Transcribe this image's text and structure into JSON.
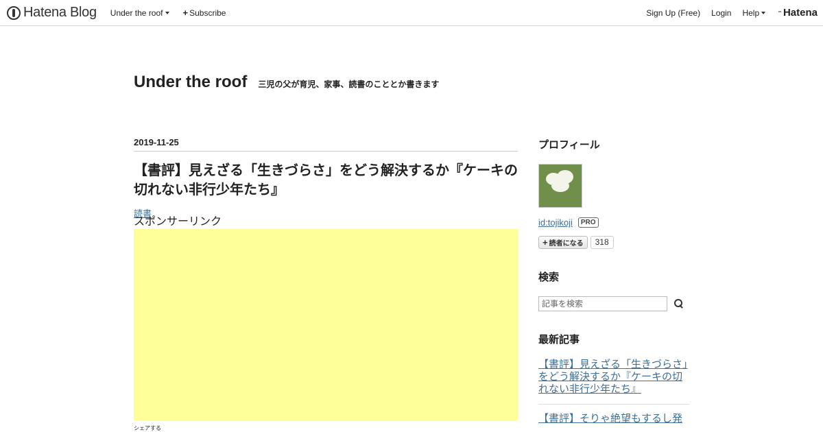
{
  "header": {
    "logo_text": "Hatena Blog",
    "blog_menu": "Under the roof",
    "subscribe": "Subscribe",
    "signup": "Sign Up (Free)",
    "login": "Login",
    "help": "Help",
    "hatena": "Hatena"
  },
  "blog": {
    "title": "Under the roof",
    "description": "三児の父が育児、家事、読書のこととか書きます"
  },
  "article": {
    "date": "2019-11-25",
    "title": "【書評】見えざる「生きづらさ」をどう解決するか『ケーキの切れない非行少年たち』",
    "category": "読書",
    "sponsor_label": "スポンサーリンク",
    "share_label": "シェアする",
    "share_colors": [
      "#1f8dd6",
      "#3b5998",
      "#55acee",
      "#dd4b39",
      "#e0455c"
    ]
  },
  "sidebar": {
    "profile_title": "プロフィール",
    "profile_id": "id:tojikoji",
    "pro_badge": "PRO",
    "subscribe_label": "読者になる",
    "subscriber_count": "318",
    "search_title": "検索",
    "search_placeholder": "記事を検索",
    "recent_title": "最新記事",
    "recent_items": [
      "【書評】見えざる「生きづらさ」をどう解決するか『ケーキの切れない非行少年たち』",
      "【書評】そりゃ絶望もするし発"
    ]
  },
  "colors": {
    "link": "#3d6f98",
    "ad_background": "#ffff99"
  }
}
